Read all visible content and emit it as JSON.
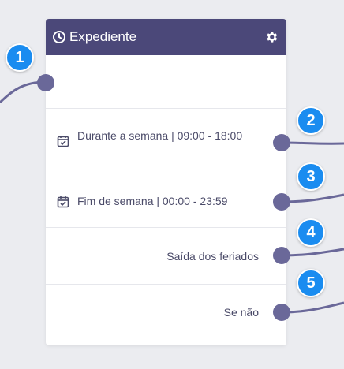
{
  "node": {
    "title": "Expediente",
    "clock_icon": "clock-icon",
    "settings_icon": "gear-icon"
  },
  "rows": [
    {
      "label": ""
    },
    {
      "label": "Durante a semana | 09:00 - 18:00",
      "icon": "calendar-check-icon"
    },
    {
      "label": "Fim de semana | 00:00 - 23:59",
      "icon": "calendar-check-icon"
    },
    {
      "label": "Saída dos feriados"
    },
    {
      "label": "Se não"
    }
  ],
  "badges": [
    "1",
    "2",
    "3",
    "4",
    "5"
  ],
  "colors": {
    "header": "#4b4879",
    "connector": "#6a6899",
    "badge": "#1a8cf0",
    "background": "#ebecf0"
  }
}
